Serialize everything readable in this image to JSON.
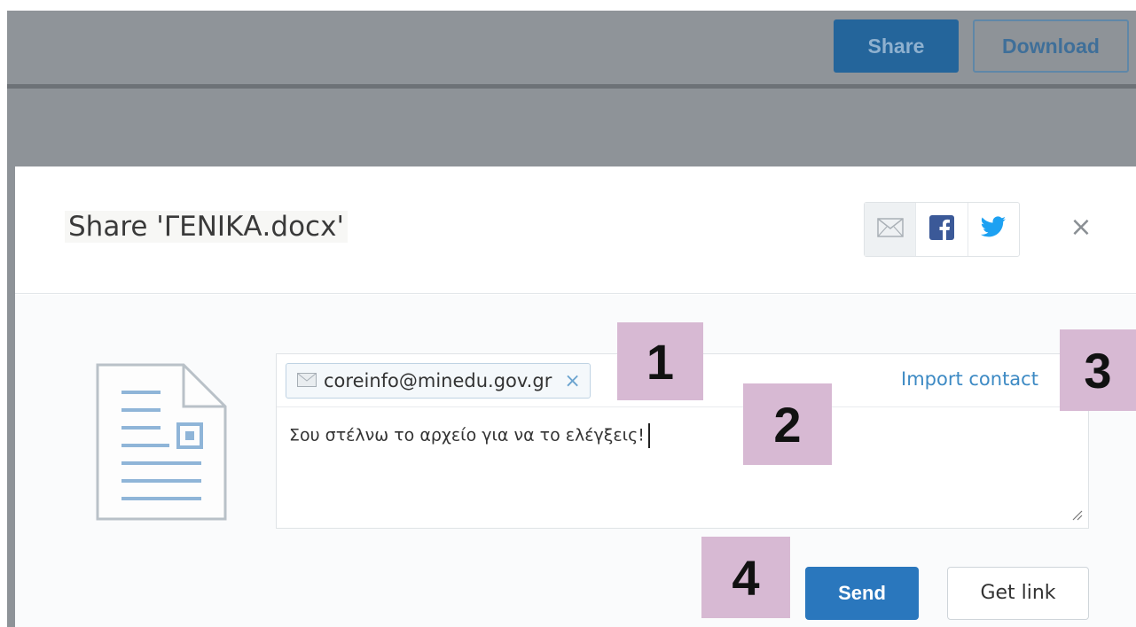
{
  "background_app": {
    "share_label": "Share",
    "download_label": "Download"
  },
  "modal": {
    "title": "Share 'ΓΕΝΙΚΑ.docx'",
    "social": {
      "email_icon": "envelope-icon",
      "facebook_icon": "facebook-icon",
      "twitter_icon": "twitter-icon"
    },
    "close_label": "×",
    "recipients": [
      {
        "email": "coreinfo@minedu.gov.gr",
        "remove": "×"
      }
    ],
    "import_label": "Import contact",
    "message": "Σου στέλνω το αρχείο για να το ελέγξεις!",
    "send_label": "Send",
    "get_link_label": "Get link"
  },
  "callouts": {
    "one": "1",
    "two": "2",
    "three": "3",
    "four": "4"
  },
  "colors": {
    "primary": "#2a77bd",
    "link": "#3d8ac4",
    "callout": "#d7b9d3",
    "backdrop": "#8e9398"
  }
}
